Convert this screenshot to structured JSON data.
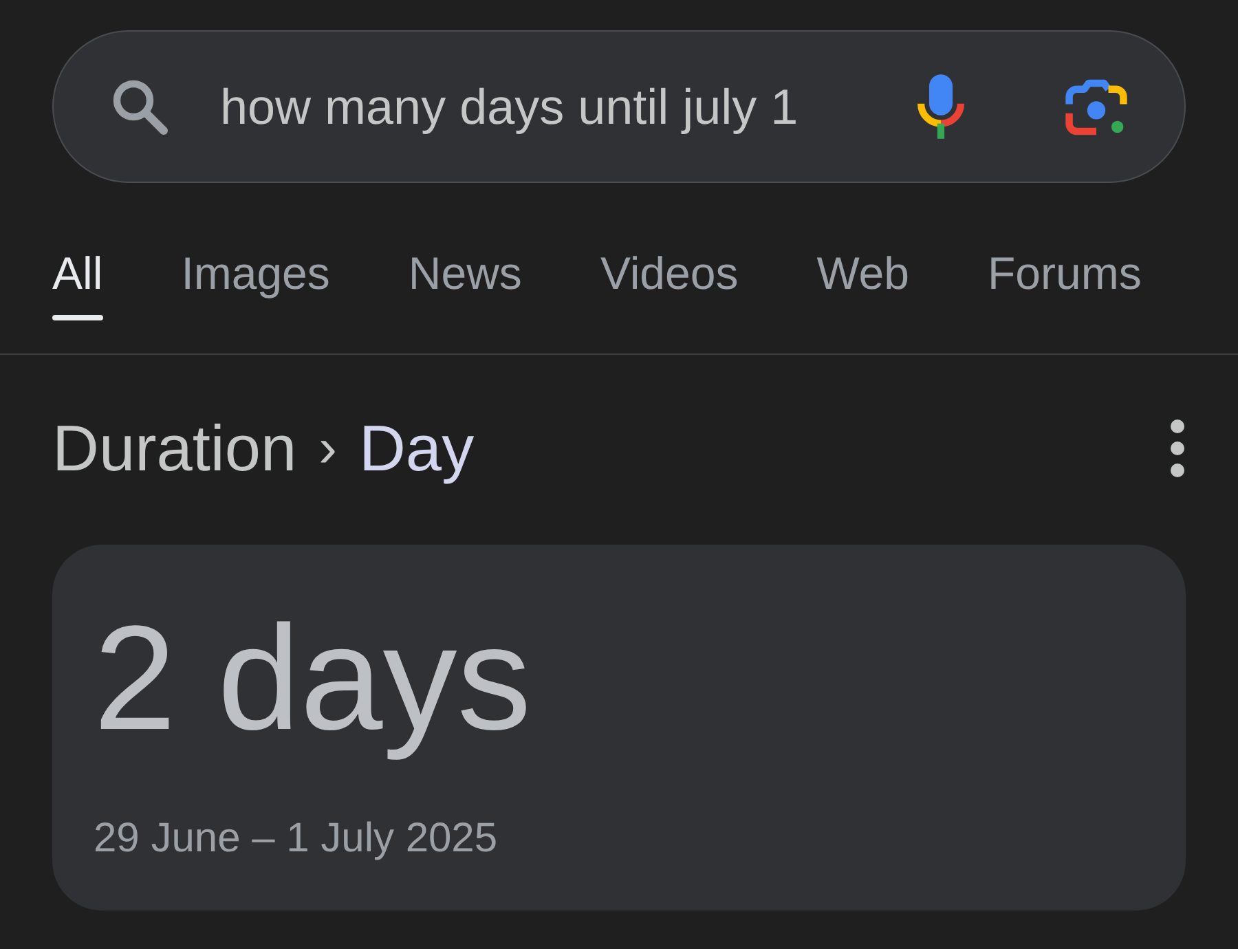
{
  "search": {
    "value": "how many days until july 1"
  },
  "tabs": [
    {
      "label": "All",
      "selected": true
    },
    {
      "label": "Images",
      "selected": false
    },
    {
      "label": "News",
      "selected": false
    },
    {
      "label": "Videos",
      "selected": false
    },
    {
      "label": "Web",
      "selected": false
    },
    {
      "label": "Forums",
      "selected": false
    }
  ],
  "breadcrumb": {
    "items": [
      {
        "label": "Duration"
      },
      {
        "label": "Day"
      }
    ],
    "separator": "›"
  },
  "result": {
    "value": "2 days",
    "range": "29 June – 1 July 2025"
  }
}
